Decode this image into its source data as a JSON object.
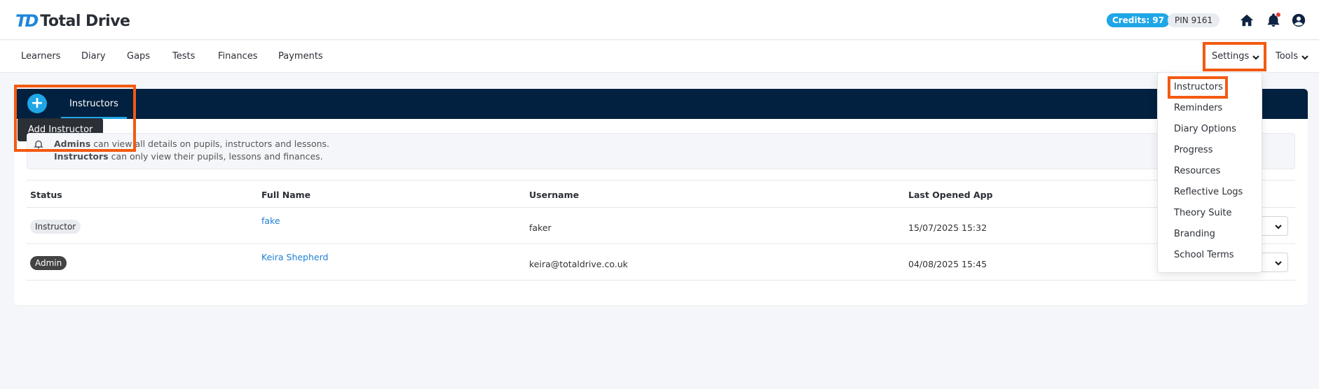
{
  "header": {
    "logo_mark": "TD",
    "logo_text": "Total Drive",
    "credits": "Credits: 97",
    "pin": "PIN 9161",
    "icons": [
      "home-icon",
      "bell-icon",
      "user-icon"
    ]
  },
  "nav": {
    "items": [
      "Learners",
      "Diary",
      "Gaps",
      "Tests",
      "Finances",
      "Payments"
    ],
    "settings": "Settings",
    "tools": "Tools"
  },
  "settings_menu": {
    "items": [
      "Instructors",
      "Reminders",
      "Diary Options",
      "Progress",
      "Resources",
      "Reflective Logs",
      "Theory Suite",
      "Branding",
      "School Terms"
    ]
  },
  "panel": {
    "add_icon": "+",
    "tab_label": "Instructors",
    "tooltip": "Add Instructor",
    "info": {
      "line1_bold": "Admins",
      "line1_rest": " can view all details on pupils, instructors and lessons.",
      "line2_bold": "Instructors",
      "line2_rest": " can only view their pupils, lessons and finances."
    }
  },
  "table": {
    "columns": [
      "Status",
      "Full Name",
      "Username",
      "Last Opened App"
    ],
    "rows": [
      {
        "status": "Instructor",
        "name": "fake",
        "username": "faker",
        "last_opened": "15/07/2025 15:32"
      },
      {
        "status": "Admin",
        "name": "Keira Shepherd",
        "username": "keira@totaldrive.co.uk",
        "last_opened": "04/08/2025 15:45"
      }
    ]
  },
  "colors": {
    "brand_blue": "#1ea6e6",
    "navy": "#02203f",
    "highlight": "#f25a12",
    "link": "#2181d6"
  }
}
